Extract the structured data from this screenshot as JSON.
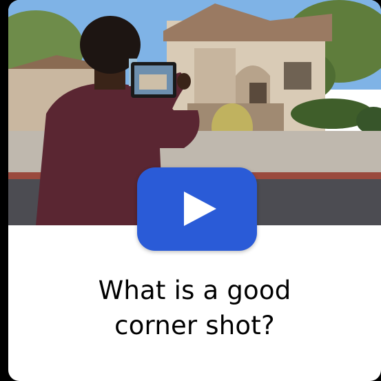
{
  "video_card": {
    "caption_line1": "What is a good",
    "caption_line2": "corner shot?",
    "play_button_color": "#2a5bd7",
    "play_icon": "play-icon",
    "thumbnail_subject": "person photographing a house with a tablet"
  }
}
